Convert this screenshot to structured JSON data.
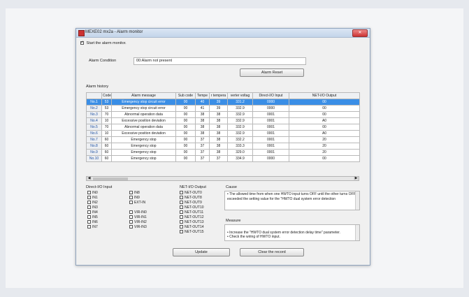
{
  "window": {
    "title": "MEXE02 mx2a - Alarm monitor",
    "close_label": "✕"
  },
  "monitor": {
    "start_label": "Start the alarm monitor.",
    "start_checked": true
  },
  "alarm_condition": {
    "label": "Alarm Condition",
    "value": "00:Alarm not present",
    "reset_label": "Alarm Reset"
  },
  "history": {
    "label": "Alarm history",
    "columns": [
      "",
      "Code",
      "Alarm message",
      "Sub code",
      "Tempe",
      "r tempera",
      "verter voltag",
      "Direct-I/O Input",
      "NET-I/O Output"
    ],
    "rows": [
      [
        "No.1",
        "53",
        "Emergency stop circuit error",
        "00",
        "40",
        "39",
        "331.2",
        "0000",
        "00"
      ],
      [
        "No.2",
        "53",
        "Emergency stop circuit error",
        "00",
        "41",
        "39",
        "332.9",
        "0000",
        "00"
      ],
      [
        "No.3",
        "70",
        "Abnormal operation data",
        "00",
        "38",
        "38",
        "332.9",
        "0001",
        "00"
      ],
      [
        "No.4",
        "10",
        "Excessive position deviation",
        "00",
        "38",
        "38",
        "332.9",
        "0001",
        "A0"
      ],
      [
        "No.5",
        "70",
        "Abnormal operation data",
        "00",
        "38",
        "38",
        "332.9",
        "0001",
        "00"
      ],
      [
        "No.6",
        "10",
        "Excessive position deviation",
        "00",
        "38",
        "38",
        "332.9",
        "0001",
        "A0"
      ],
      [
        "No.7",
        "60",
        "Emergency stop",
        "00",
        "37",
        "38",
        "332.2",
        "0001",
        "20"
      ],
      [
        "No.8",
        "60",
        "Emergency stop",
        "00",
        "37",
        "38",
        "333.3",
        "0001",
        "20"
      ],
      [
        "No.9",
        "60",
        "Emergency stop",
        "00",
        "37",
        "38",
        "329.0",
        "0001",
        "20"
      ],
      [
        "No.10",
        "60",
        "Emergency stop",
        "00",
        "37",
        "37",
        "334.9",
        "0000",
        "00"
      ]
    ],
    "selected_row": 0
  },
  "direct_io": {
    "label": "Direct-I/O Input",
    "col1": [
      "IN0",
      "IN1",
      "IN2",
      "IN3",
      "IN4",
      "IN5",
      "IN6",
      "IN7"
    ],
    "col2a": [
      "IN8",
      "IN9",
      "EXT-IN"
    ],
    "col2b": [
      "VIR-IN0",
      "VIR-IN1",
      "VIR-IN2",
      "VIR-IN3"
    ]
  },
  "net_io": {
    "label": "NET-I/O Output",
    "items": [
      "NET-OUT0",
      "NET-OUT8",
      "NET-OUT9",
      "NET-OUT10",
      "NET-OUT11",
      "NET-OUT12",
      "NET-OUT13",
      "NET-OUT14",
      "NET-OUT15"
    ]
  },
  "cause": {
    "label": "Cause",
    "text": "• The allowed time from when one HWTO input turns OFF until the other turns OFF exceeded the setting value for the \"HWTO dual system error detection"
  },
  "measure": {
    "label": "Measure",
    "text": "• Increase the \"HWTO dual system error detection delay time\" parameter.\n• Check the wiring of HWTO input."
  },
  "buttons": {
    "update": "Update",
    "clear": "Clear the record"
  },
  "colors": {
    "selection": "#3a8ee6",
    "titlebar": "#c4d5ea",
    "close": "#cc3333"
  }
}
